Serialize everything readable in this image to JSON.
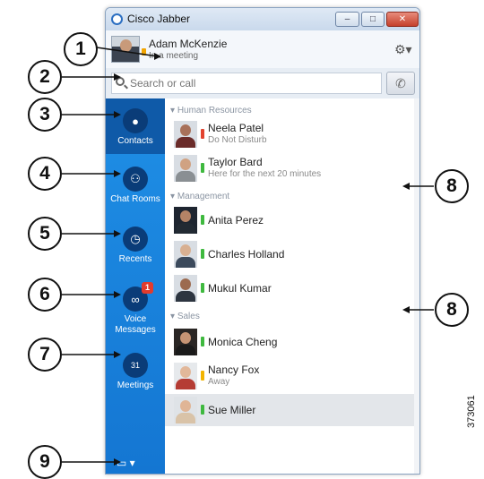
{
  "window": {
    "title": "Cisco Jabber",
    "controls": {
      "minimize": "–",
      "maximize": "□",
      "close": "✕"
    }
  },
  "user": {
    "name": "Adam McKenzie",
    "status": "In a meeting"
  },
  "search": {
    "placeholder": "Search or call"
  },
  "sidebar": {
    "items": [
      {
        "label": "Contacts",
        "icon": "person-icon"
      },
      {
        "label": "Chat Rooms",
        "icon": "chat-rooms-icon"
      },
      {
        "label": "Recents",
        "icon": "clock-icon"
      },
      {
        "label": "Voice Messages",
        "icon": "voicemail-icon",
        "badge": "1"
      },
      {
        "label": "Meetings",
        "icon": "calendar-icon",
        "calendar_day": "31"
      }
    ]
  },
  "groups": [
    {
      "name": "Human Resources"
    },
    {
      "name": "Management"
    },
    {
      "name": "Sales"
    }
  ],
  "contacts": [
    {
      "name": "Neela Patel",
      "status": "Do Not Disturb",
      "presence": "#e2432f"
    },
    {
      "name": "Taylor Bard",
      "status": "Here for the next 20 minutes",
      "presence": "#3fb93f"
    },
    {
      "name": "Anita Perez",
      "status": "",
      "presence": "#3fb93f"
    },
    {
      "name": "Charles Holland",
      "status": "",
      "presence": "#3fb93f"
    },
    {
      "name": "Mukul Kumar",
      "status": "",
      "presence": "#3fb93f"
    },
    {
      "name": "Monica Cheng",
      "status": "",
      "presence": "#3fb93f"
    },
    {
      "name": "Nancy Fox",
      "status": "Away",
      "presence": "#f2b400"
    },
    {
      "name": "Sue Miller",
      "status": "",
      "presence": "#3fb93f"
    }
  ],
  "callouts": [
    "1",
    "2",
    "3",
    "4",
    "5",
    "6",
    "7",
    "8",
    "8",
    "9"
  ],
  "figure_id": "373061"
}
